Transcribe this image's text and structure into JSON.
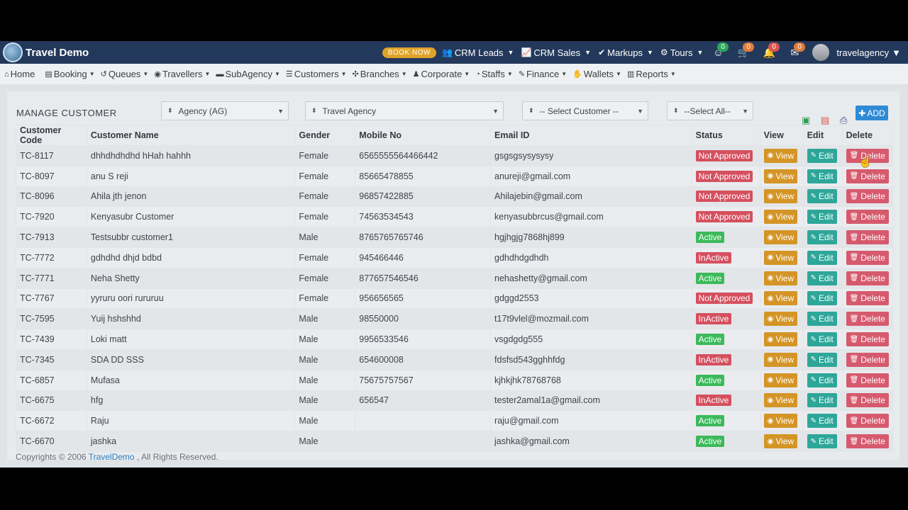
{
  "app": {
    "title": "Travel Demo"
  },
  "topbar": {
    "book_now": "BOOK NOW",
    "menus": [
      {
        "label": "CRM Leads",
        "icon": "users-icon"
      },
      {
        "label": "CRM Sales",
        "icon": "chart-icon"
      },
      {
        "label": "Markups",
        "icon": "check-circle-icon"
      },
      {
        "label": "Tours",
        "icon": "gear-icon"
      }
    ],
    "notifications": [
      {
        "name": "smile-icon",
        "count": "0",
        "color": "#2ea65a"
      },
      {
        "name": "cart-icon",
        "count": "0",
        "color": "#e07b39"
      },
      {
        "name": "bell-icon",
        "count": "0",
        "color": "#d9534f"
      },
      {
        "name": "mail-icon",
        "count": "0",
        "color": "#e07b39"
      }
    ],
    "user": "travelagency"
  },
  "nav": [
    {
      "label": "Home",
      "icon": "home-icon",
      "caret": false
    },
    {
      "label": "Booking",
      "icon": "book-icon",
      "caret": true
    },
    {
      "label": "Queues",
      "icon": "history-icon",
      "caret": true
    },
    {
      "label": "Travellers",
      "icon": "user-circle-icon",
      "caret": true
    },
    {
      "label": "SubAgency",
      "icon": "car-icon",
      "caret": true
    },
    {
      "label": "Customers",
      "icon": "list-icon",
      "caret": true
    },
    {
      "label": "Branches",
      "icon": "tree-icon",
      "caret": true
    },
    {
      "label": "Corporate",
      "icon": "group-icon",
      "caret": true
    },
    {
      "label": "Staffs",
      "icon": "user-icon",
      "caret": true
    },
    {
      "label": "Finance",
      "icon": "pencil-icon",
      "caret": true
    },
    {
      "label": "Wallets",
      "icon": "handshake-icon",
      "caret": true
    },
    {
      "label": "Reports",
      "icon": "bar-chart-icon",
      "caret": true
    }
  ],
  "panel": {
    "title": "MANAGE CUSTOMER",
    "filters": {
      "agency": "Agency (AG)",
      "travel_agency": "Travel Agency",
      "customer": "-- Select Customer --",
      "status": "--Select All--"
    },
    "add_label": "ADD"
  },
  "table": {
    "headers": [
      "Customer Code",
      "Customer Name",
      "Gender",
      "Mobile No",
      "Email ID",
      "Status",
      "View",
      "Edit",
      "Delete"
    ],
    "action_labels": {
      "view": "View",
      "edit": "Edit",
      "delete": "Delete"
    },
    "rows": [
      {
        "code": "TC-8117",
        "name": "dhhdhdhdhd hHah hahhh",
        "gender": "Female",
        "mobile": "6565555564466442",
        "email": "gsgsgsysysysy",
        "status": "Not Approved"
      },
      {
        "code": "TC-8097",
        "name": "anu S reji",
        "gender": "Female",
        "mobile": "85665478855",
        "email": "anureji@gmail.com",
        "status": "Not Approved"
      },
      {
        "code": "TC-8096",
        "name": "Ahila jth jenon",
        "gender": "Female",
        "mobile": "96857422885",
        "email": "Ahilajebin@gmail.com",
        "status": "Not Approved"
      },
      {
        "code": "TC-7920",
        "name": "Kenyasubr Customer",
        "gender": "Female",
        "mobile": "74563534543",
        "email": "kenyasubbrcus@gmail.com",
        "status": "Not Approved"
      },
      {
        "code": "TC-7913",
        "name": "Testsubbr customer1",
        "gender": "Male",
        "mobile": "8765765765746",
        "email": "hgjhgjg7868hj899",
        "status": "Active"
      },
      {
        "code": "TC-7772",
        "name": "gdhdhd dhjd bdbd",
        "gender": "Female",
        "mobile": "945466446",
        "email": "gdhdhdgdhdh",
        "status": "InActive"
      },
      {
        "code": "TC-7771",
        "name": "Neha Shetty",
        "gender": "Female",
        "mobile": "877657546546",
        "email": "nehashetty@gmail.com",
        "status": "Active"
      },
      {
        "code": "TC-7767",
        "name": "yyruru oori rururuu",
        "gender": "Female",
        "mobile": "956656565",
        "email": "gdggd2553",
        "status": "Not Approved"
      },
      {
        "code": "TC-7595",
        "name": "Yuij hshshhd",
        "gender": "Male",
        "mobile": "98550000",
        "email": "t17t9vlel@mozmail.com",
        "status": "InActive"
      },
      {
        "code": "TC-7439",
        "name": "Loki matt",
        "gender": "Male",
        "mobile": "9956533546",
        "email": "vsgdgdg555",
        "status": "Active"
      },
      {
        "code": "TC-7345",
        "name": "SDA DD SSS",
        "gender": "Male",
        "mobile": "654600008",
        "email": "fdsfsd543gghhfdg",
        "status": "InActive"
      },
      {
        "code": "TC-6857",
        "name": "Mufasa",
        "gender": "Male",
        "mobile": "75675757567",
        "email": "kjhkjhk78768768",
        "status": "Active"
      },
      {
        "code": "TC-6675",
        "name": "hfg",
        "gender": "Male",
        "mobile": "656547",
        "email": "tester2amal1a@gmail.com",
        "status": "InActive"
      },
      {
        "code": "TC-6672",
        "name": "Raju",
        "gender": "Male",
        "mobile": "",
        "email": "raju@gmail.com",
        "status": "Active"
      },
      {
        "code": "TC-6670",
        "name": "jashka",
        "gender": "Male",
        "mobile": "",
        "email": "jashka@gmail.com",
        "status": "Active"
      }
    ]
  },
  "status_colors": {
    "Not Approved": "#d5505f",
    "Active": "#3cb95a",
    "InActive": "#d5505f"
  },
  "footer": {
    "prefix": "Copyrights © 2006",
    "link": "TravelDemo",
    "suffix": ", All Rights Reserved."
  }
}
